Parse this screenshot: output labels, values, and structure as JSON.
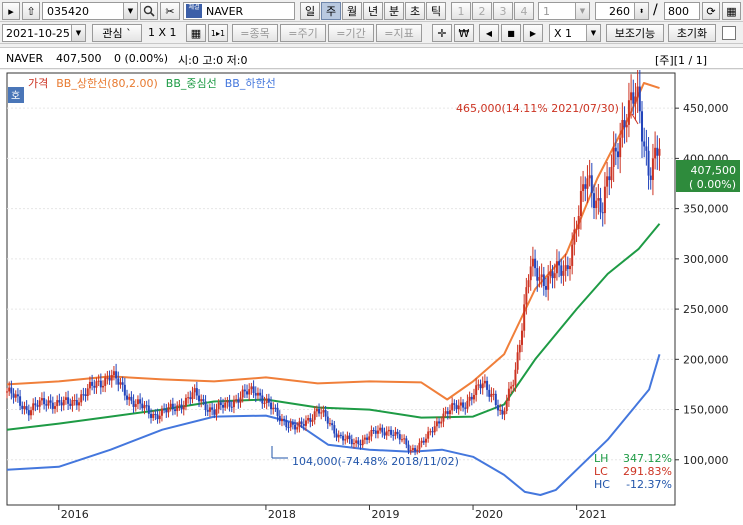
{
  "toolbar1": {
    "code": "035420",
    "name": "NAVER",
    "name_badge": "체결",
    "periods": [
      "일",
      "주",
      "월",
      "년",
      "분",
      "초",
      "틱"
    ],
    "active_period": "주",
    "nums": [
      "1",
      "2",
      "3",
      "4"
    ],
    "interval": "1",
    "count": "260",
    "slash": "/",
    "total": "800"
  },
  "toolbar2": {
    "date": "2021-10-25",
    "watch": "관심",
    "grid": "1 X 1",
    "grid_btn": "1▸1",
    "fav_item": "=종목",
    "fav_period": "=주기",
    "fav_range": "=기간",
    "fav_ind": "=지표",
    "multiplier": "X 1",
    "aux": "보조기능",
    "reset": "초기화"
  },
  "infobar": {
    "name": "NAVER",
    "price": "407,500",
    "change": "0 (0.00%)",
    "ohlc": "시:0 고:0 저:0",
    "page": "[주][1 / 1]"
  },
  "colors": {
    "price": "#cc3322",
    "down": "#2244bb",
    "upper": "#f07f3a",
    "middle": "#1e9b45",
    "lower": "#4477dd"
  },
  "legend": {
    "badge": "호",
    "items": [
      {
        "label": "가격",
        "color": "#cc3322"
      },
      {
        "label": "BB_상한선(80,2.00)",
        "color": "#e87a30"
      },
      {
        "label": "BB_중심선",
        "color": "#1e9b45"
      },
      {
        "label": "BB_하한선",
        "color": "#4477dd"
      }
    ]
  },
  "chart_data": {
    "type": "line",
    "x_ticks": [
      "2016",
      "2018",
      "2019",
      "2020",
      "2021"
    ],
    "y_ticks": [
      "450,000",
      "400,000",
      "350,000",
      "300,000",
      "250,000",
      "200,000",
      "150,000",
      "100,000"
    ],
    "ylim": [
      55000,
      485000
    ],
    "current": {
      "price": "407,500",
      "change": "( 0.00%)"
    },
    "annotations": {
      "high": "465,000(14.11% 2021/07/30)",
      "low": "104,000(-74.48% 2018/11/02)"
    },
    "stats": [
      {
        "label": "LH",
        "value": "347.12%"
      },
      {
        "label": "LC",
        "value": "291.83%"
      },
      {
        "label": "HC",
        "value": "-12.37%"
      }
    ],
    "series": [
      {
        "name": "가격",
        "x": [
          2015.5,
          2015.7,
          2015.9,
          2016.1,
          2016.3,
          2016.5,
          2016.7,
          2016.9,
          2017.1,
          2017.3,
          2017.5,
          2017.7,
          2017.9,
          2018.1,
          2018.3,
          2018.5,
          2018.7,
          2018.85,
          2019.0,
          2019.2,
          2019.4,
          2019.55,
          2019.7,
          2019.9,
          2020.1,
          2020.2,
          2020.28,
          2020.4,
          2020.55,
          2020.7,
          2020.9,
          2021.1,
          2021.25,
          2021.45,
          2021.58,
          2021.7,
          2021.8
        ],
        "y": [
          168000,
          150000,
          158000,
          155000,
          170000,
          185000,
          160000,
          145000,
          150000,
          165000,
          148000,
          160000,
          170000,
          145000,
          130000,
          150000,
          125000,
          115000,
          125000,
          130000,
          110000,
          120000,
          145000,
          155000,
          175000,
          165000,
          140000,
          185000,
          290000,
          280000,
          290000,
          380000,
          350000,
          440000,
          460000,
          390000,
          407500
        ]
      },
      {
        "name": "BB_상한선",
        "x": [
          2015.5,
          2016.0,
          2016.5,
          2017.0,
          2017.5,
          2018.0,
          2018.5,
          2019.0,
          2019.5,
          2019.75,
          2020.0,
          2020.3,
          2020.6,
          2020.9,
          2021.2,
          2021.5,
          2021.65,
          2021.8
        ],
        "y": [
          175000,
          178000,
          183000,
          180000,
          178000,
          182000,
          176000,
          178000,
          177000,
          160000,
          178000,
          205000,
          270000,
          305000,
          380000,
          440000,
          475000,
          470000
        ]
      },
      {
        "name": "BB_중심선",
        "x": [
          2015.5,
          2016.0,
          2016.5,
          2017.0,
          2017.5,
          2018.0,
          2018.5,
          2019.0,
          2019.5,
          2020.0,
          2020.3,
          2020.6,
          2021.0,
          2021.3,
          2021.6,
          2021.8
        ],
        "y": [
          130000,
          136000,
          143000,
          150000,
          158000,
          160000,
          152000,
          150000,
          142000,
          143000,
          155000,
          200000,
          250000,
          285000,
          310000,
          335000
        ]
      },
      {
        "name": "BB_하한선",
        "x": [
          2015.5,
          2016.0,
          2016.5,
          2017.0,
          2017.5,
          2018.0,
          2018.3,
          2018.6,
          2019.0,
          2019.4,
          2019.7,
          2020.0,
          2020.3,
          2020.5,
          2020.65,
          2020.8,
          2021.0,
          2021.3,
          2021.5,
          2021.7,
          2021.8
        ],
        "y": [
          90000,
          93000,
          110000,
          130000,
          143000,
          144000,
          136000,
          115000,
          110000,
          108000,
          110000,
          103000,
          85000,
          68000,
          65000,
          70000,
          90000,
          120000,
          145000,
          170000,
          205000
        ]
      }
    ]
  }
}
